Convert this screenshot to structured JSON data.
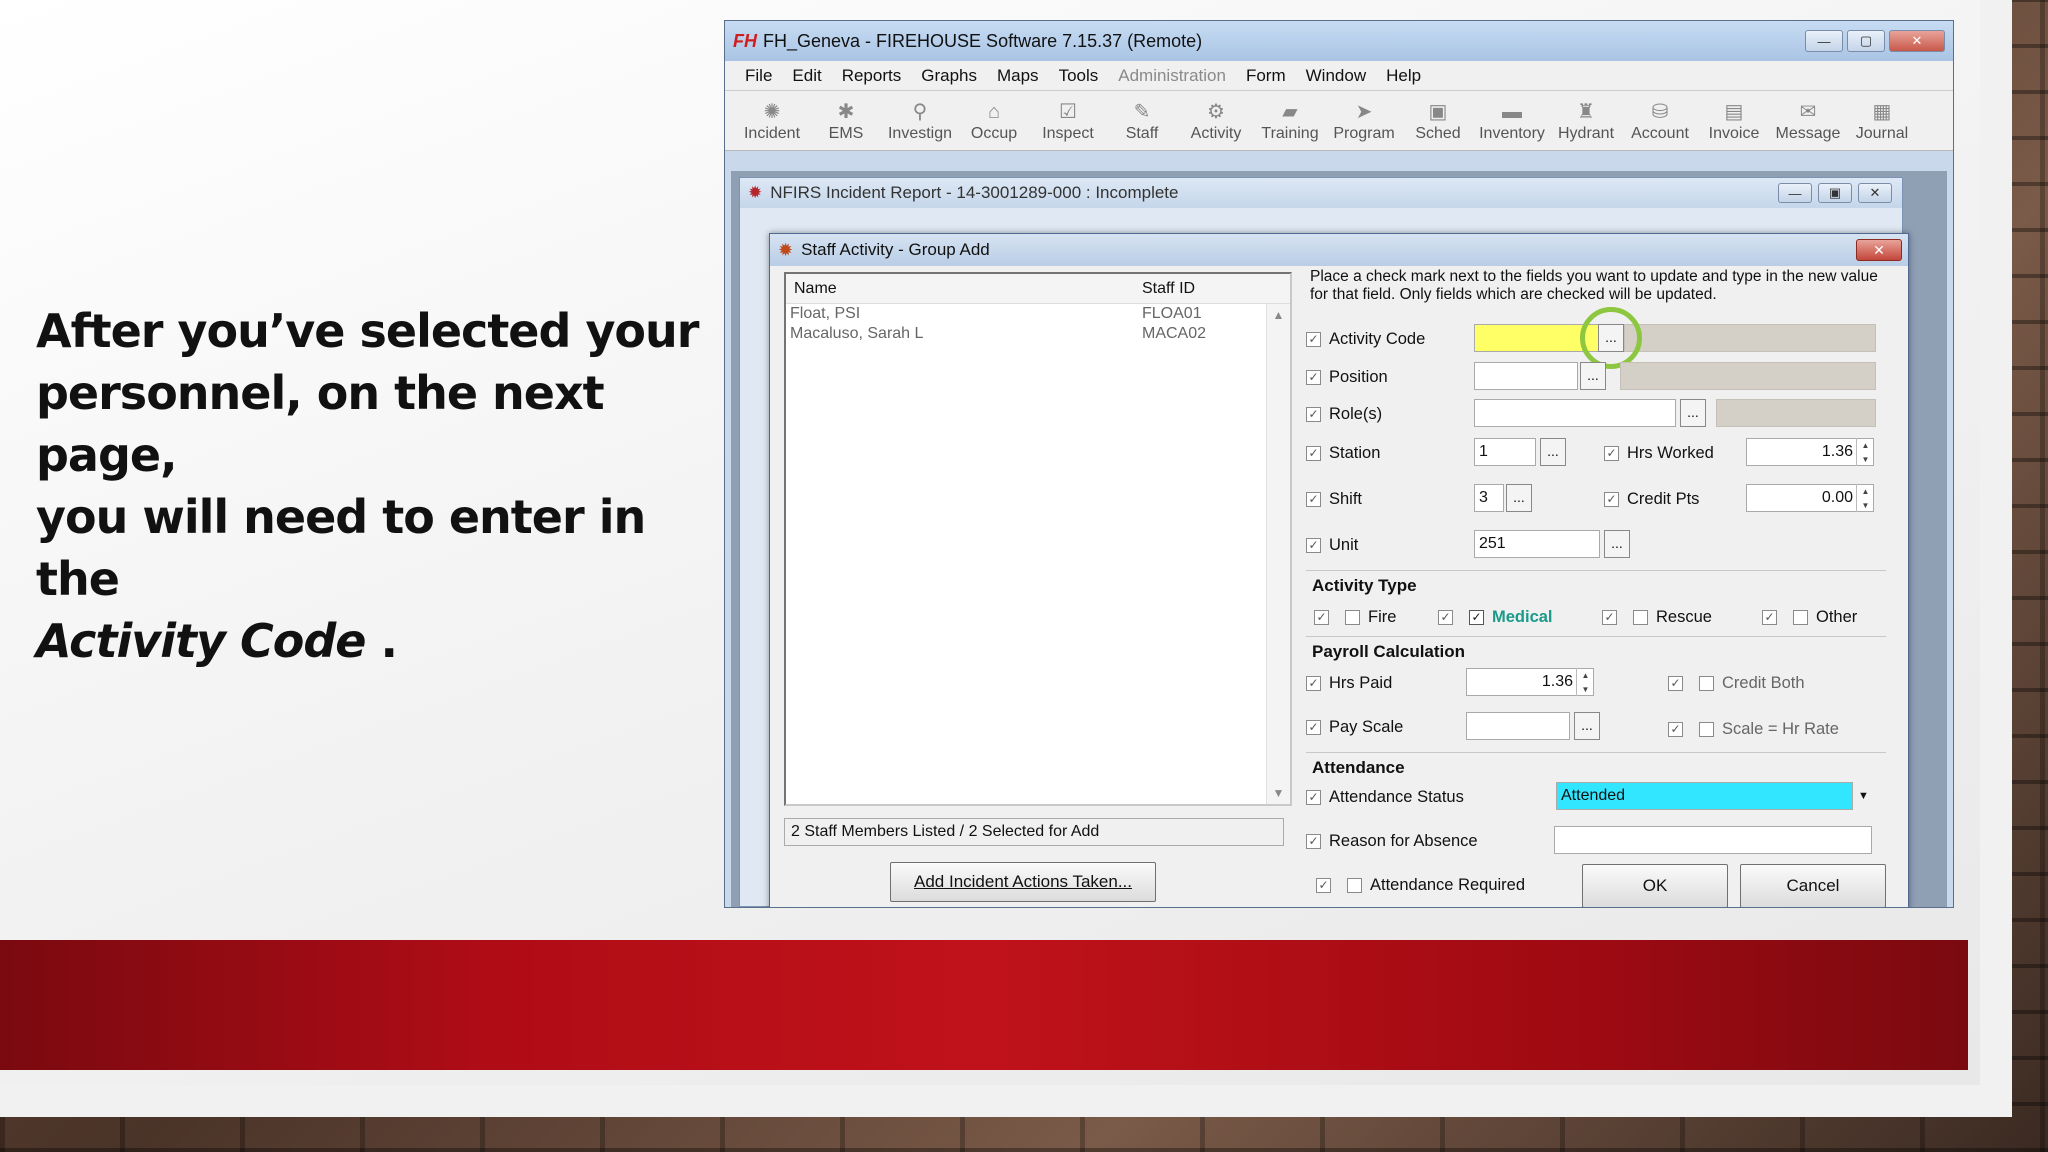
{
  "slide": {
    "line1": "After you’ve selected your",
    "line2": "personnel, on the next page,",
    "line3": "you will need to enter in the",
    "emph": "Activity Code",
    "end": " ."
  },
  "app": {
    "logo": "FH",
    "title": "FH_Geneva - FIREHOUSE Software 7.15.37 (Remote)",
    "menu": [
      "File",
      "Edit",
      "Reports",
      "Graphs",
      "Maps",
      "Tools",
      "Administration",
      "Form",
      "Window",
      "Help"
    ],
    "toolbar": [
      {
        "label": "Incident",
        "icon": "incident-icon"
      },
      {
        "label": "EMS",
        "icon": "ems-icon"
      },
      {
        "label": "Investign",
        "icon": "investigation-icon"
      },
      {
        "label": "Occup",
        "icon": "occupancy-icon"
      },
      {
        "label": "Inspect",
        "icon": "inspect-icon"
      },
      {
        "label": "Staff",
        "icon": "staff-icon"
      },
      {
        "label": "Activity",
        "icon": "activity-icon"
      },
      {
        "label": "Training",
        "icon": "training-icon"
      },
      {
        "label": "Program",
        "icon": "program-icon"
      },
      {
        "label": "Sched",
        "icon": "schedule-icon"
      },
      {
        "label": "Inventory",
        "icon": "inventory-icon"
      },
      {
        "label": "Hydrant",
        "icon": "hydrant-icon"
      },
      {
        "label": "Account",
        "icon": "account-icon"
      },
      {
        "label": "Invoice",
        "icon": "invoice-icon"
      },
      {
        "label": "Message",
        "icon": "message-icon"
      },
      {
        "label": "Journal",
        "icon": "journal-icon"
      }
    ]
  },
  "nfirs": {
    "title": "NFIRS Incident Report   - 14-3001289-000   : Incomplete"
  },
  "dialog": {
    "title": "Staff Activity - Group Add",
    "list": {
      "col_name": "Name",
      "col_id": "Staff ID",
      "rows": [
        {
          "name": "Float, PSI",
          "id": "FLOA01"
        },
        {
          "name": "Macaluso, Sarah L",
          "id": "MACA02"
        }
      ],
      "status": "2 Staff Members Listed / 2 Selected for Add"
    },
    "add_actions_label": "Add Incident Actions Taken...",
    "instructions": "Place a check mark next to the fields you want to update and type in the new value for that field. Only fields which are checked will be updated.",
    "fields": {
      "activity_code": "Activity Code",
      "position": "Position",
      "roles": "Role(s)",
      "station": "Station",
      "station_value": "1",
      "hrs_worked": "Hrs Worked",
      "hrs_worked_value": "1.36",
      "shift": "Shift",
      "shift_value": "3",
      "credit_pts": "Credit Pts",
      "credit_pts_value": "0.00",
      "unit": "Unit",
      "unit_value": "251"
    },
    "activity_type": {
      "title": "Activity Type",
      "fire": "Fire",
      "medical": "Medical",
      "rescue": "Rescue",
      "other": "Other"
    },
    "payroll": {
      "title": "Payroll Calculation",
      "hrs_paid": "Hrs Paid",
      "hrs_paid_value": "1.36",
      "pay_scale": "Pay Scale",
      "credit_both": "Credit Both",
      "scale_hr_rate": "Scale = Hr Rate"
    },
    "attendance": {
      "title": "Attendance",
      "status_label": "Attendance Status",
      "status_value": "Attended",
      "reason_label": "Reason for Absence",
      "required_label": "Attendance Required"
    },
    "ok": "OK",
    "cancel": "Cancel",
    "dots": "...",
    "check": "✓",
    "highlight_color": "#8dc63f",
    "yellow": "#ffff66",
    "cyan": "#33e6ff"
  }
}
